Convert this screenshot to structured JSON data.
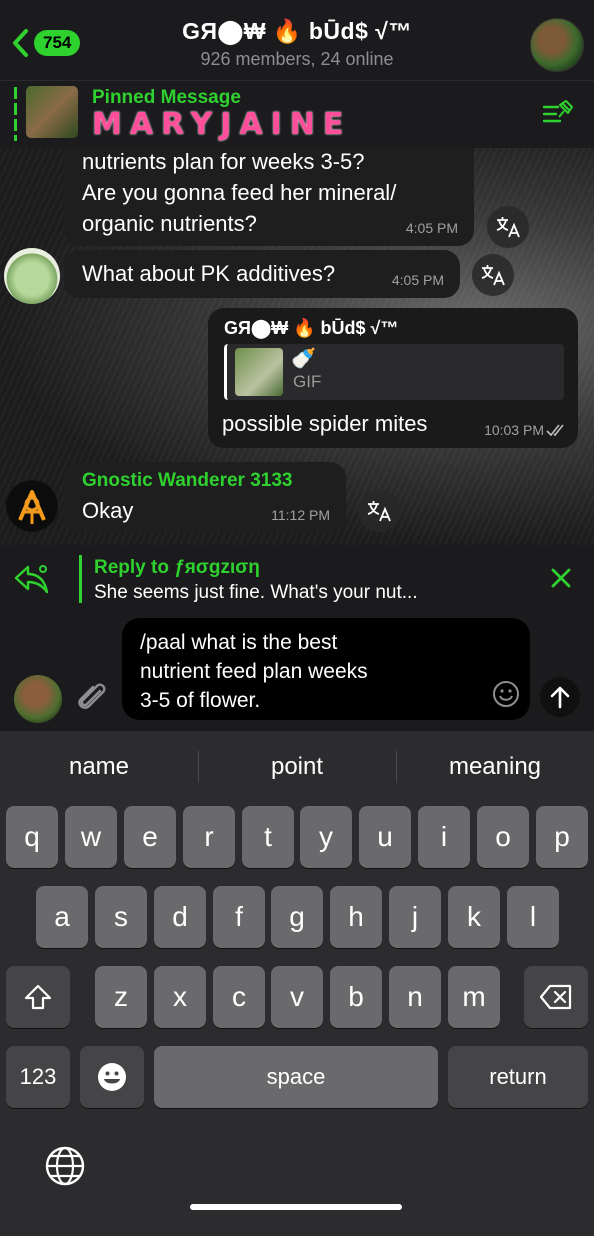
{
  "header": {
    "unread_badge": "754",
    "title": "GЯ⬤₩ 🔥 bŪd$ √™",
    "subtitle": "926 members, 24 online"
  },
  "pinned": {
    "label": "Pinned Message",
    "text": "MARYJAINE"
  },
  "messages": [
    {
      "lines": [
        "nutrients plan for weeks 3-5?",
        "Are you gonna feed her mineral/",
        "organic nutrients?"
      ],
      "time": "4:05 PM"
    },
    {
      "text": "What about PK additives?",
      "time": "4:05 PM"
    },
    {
      "sender": "GЯ⬤₩ 🔥 bŪd$ √™",
      "attachment_emoji": "🍼",
      "attachment_type": "GIF",
      "text": "possible spider mites",
      "time": "10:03 PM"
    },
    {
      "sender": "Gnostic Wanderer 3133",
      "text": "Okay",
      "time": "11:12 PM"
    }
  ],
  "reply": {
    "title": "Reply to ƒяσgzιση",
    "text": "She seems just fine. What's your nut..."
  },
  "input": {
    "lines": [
      "/paal what is the best",
      "nutrient feed plan weeks",
      "3-5 of flower."
    ]
  },
  "keyboard": {
    "suggestions": [
      "name",
      "point",
      "meaning"
    ],
    "row1": [
      "q",
      "w",
      "e",
      "r",
      "t",
      "y",
      "u",
      "i",
      "o",
      "p"
    ],
    "row2": [
      "a",
      "s",
      "d",
      "f",
      "g",
      "h",
      "j",
      "k",
      "l"
    ],
    "row3": [
      "z",
      "x",
      "c",
      "v",
      "b",
      "n",
      "m"
    ],
    "numbers_label": "123",
    "space_label": "space",
    "return_label": "return"
  },
  "colors": {
    "accent": "#2fd12f",
    "pinned_text": "#ff4f9a"
  }
}
